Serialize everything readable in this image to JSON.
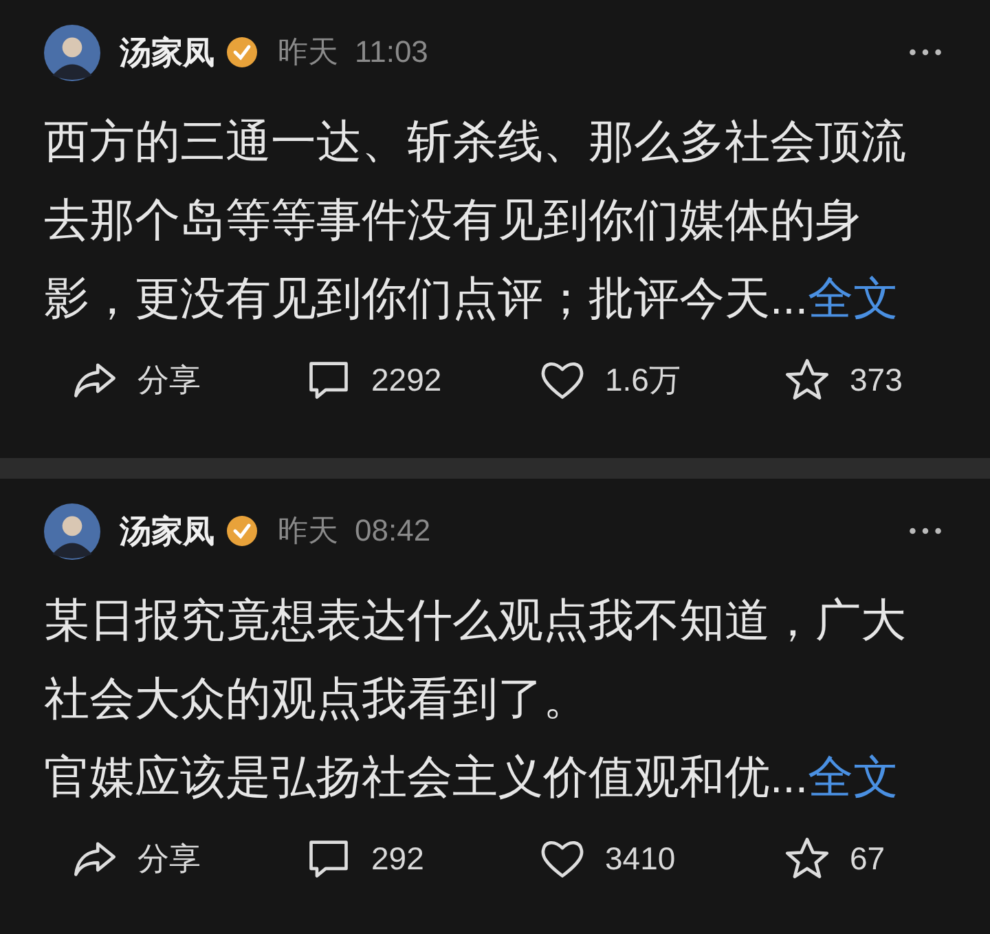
{
  "posts": [
    {
      "author": "汤家凤",
      "verified": true,
      "date": "昨天",
      "time": "11:03",
      "paragraphs": [
        "西方的三通一达、斩杀线、那么多社会顶流去那个岛等等事件没有见到你们媒体的身影，更没有见到你们点评；批评今天..."
      ],
      "more_link": "全文",
      "actions": [
        {
          "kind": "share",
          "label": "分享"
        },
        {
          "kind": "comment",
          "label": "2292"
        },
        {
          "kind": "like",
          "label": "1.6万"
        },
        {
          "kind": "favorite",
          "label": "373"
        }
      ]
    },
    {
      "author": "汤家凤",
      "verified": true,
      "date": "昨天",
      "time": "08:42",
      "paragraphs": [
        "某日报究竟想表达什么观点我不知道，广大社会大众的观点我看到了。",
        "官媒应该是弘扬社会主义价值观和优..."
      ],
      "more_link": "全文",
      "actions": [
        {
          "kind": "share",
          "label": "分享"
        },
        {
          "kind": "comment",
          "label": "292"
        },
        {
          "kind": "like",
          "label": "3410"
        },
        {
          "kind": "favorite",
          "label": "67"
        }
      ]
    }
  ]
}
